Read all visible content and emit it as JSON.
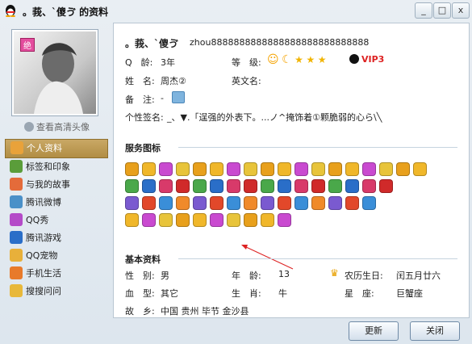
{
  "window": {
    "title": "。莪、`傻ゔ 的资料",
    "buttons": {
      "minimize": "_",
      "maximize": "□",
      "close": "x"
    }
  },
  "left": {
    "avatar_badge": "绝",
    "hd_link": "查看高清头像",
    "nav": [
      {
        "label": "个人资料",
        "active": true,
        "icon": "person-icon",
        "color": "#e9a23a"
      },
      {
        "label": "标签和印象",
        "active": false,
        "icon": "tag-icon",
        "color": "#5a9d3a"
      },
      {
        "label": "与我的故事",
        "active": false,
        "icon": "rainbow-icon",
        "color": "#e46b3a"
      },
      {
        "label": "腾讯微博",
        "active": false,
        "icon": "weibo-icon",
        "color": "#4a90c8"
      },
      {
        "label": "QQ秀",
        "active": false,
        "icon": "qqshow-icon",
        "color": "#b44ac8"
      },
      {
        "label": "腾讯游戏",
        "active": false,
        "icon": "game-icon",
        "color": "#2a6ec8"
      },
      {
        "label": "QQ宠物",
        "active": false,
        "icon": "pet-icon",
        "color": "#e8b03a"
      },
      {
        "label": "手机生活",
        "active": false,
        "icon": "phone-icon",
        "color": "#e87a2a"
      },
      {
        "label": "搜搜问问",
        "active": false,
        "icon": "question-icon",
        "color": "#e8b83a"
      }
    ]
  },
  "profile": {
    "nickname": "。莪、`傻ゔ",
    "signature_id": "zhou8888888888888888888888888888",
    "qq_age_label": "Q　龄:",
    "qq_age": "3年",
    "level_label": "等　级:",
    "vip": "VIP3",
    "name_label": "姓　名:",
    "name": "周杰②",
    "en_name_label": "英文名:",
    "en_name": "",
    "remark_label": "备　注:",
    "remark": "-",
    "sig_label": "个性签名:",
    "sig": "_、▼.「逞强的外表下。...ノ^掩饰着①颗脆弱的心ら\\╲"
  },
  "service": {
    "title": "服务图标"
  },
  "basic": {
    "title": "基本资料",
    "gender_label": "性　别:",
    "gender": "男",
    "age_label": "年　龄:",
    "age": "13",
    "lunar_label": "农历生日:",
    "lunar": "闰五月廿六",
    "blood_label": "血　型:",
    "blood": "其它",
    "zodiac_label": "生　肖:",
    "zodiac": "牛",
    "star_label": "星　座:",
    "star": "巨蟹座",
    "hometown_label": "故　乡:",
    "hometown": "中国 贵州 毕节 金沙县"
  },
  "footer": {
    "refresh": "更新",
    "close": "关闭"
  }
}
